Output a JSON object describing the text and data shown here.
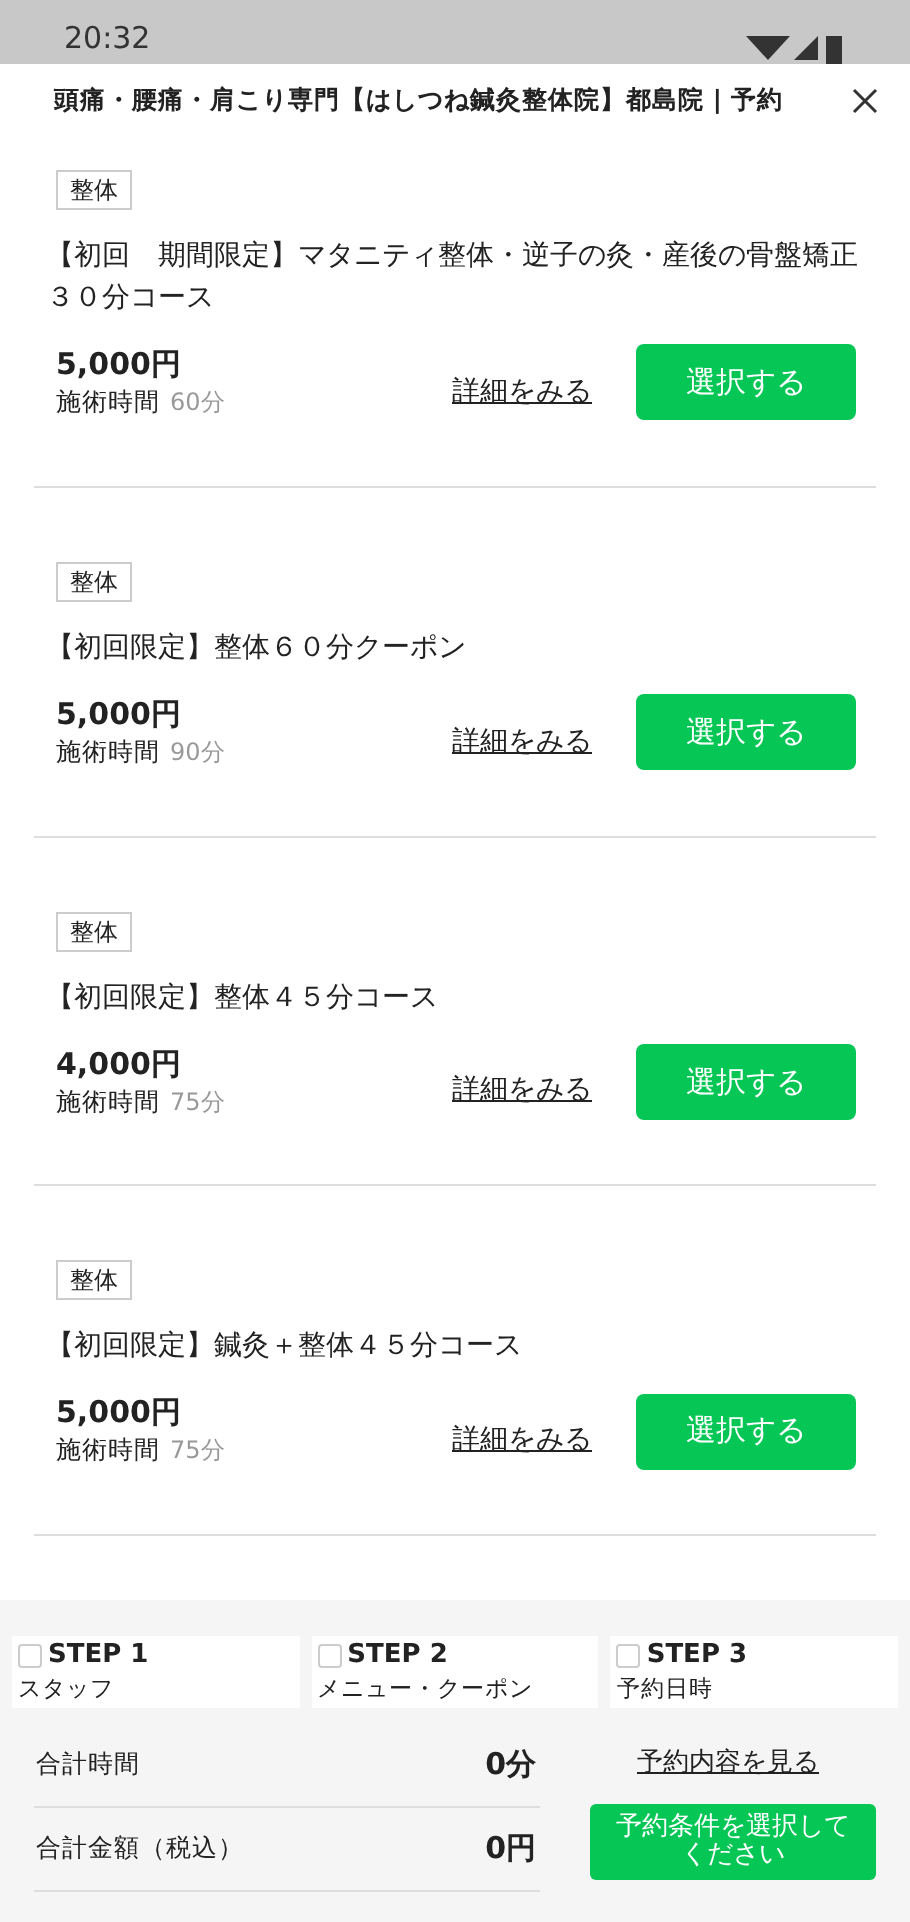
{
  "status_bar": {
    "time": "20:32"
  },
  "header": {
    "title": "頭痛・腰痛・肩こり専門【はしつね鍼灸整体院】都島院 | 予約"
  },
  "menus": [
    {
      "tag": "整体",
      "title": "【初回　期間限定】マタニティ整体・逆子の灸・産後の骨盤矯正３０分コース",
      "price": "5,000円",
      "time_label": "施術時間",
      "duration": "60分",
      "detail_link": "詳細をみる",
      "select_button": "選択する"
    },
    {
      "tag": "整体",
      "title": "【初回限定】整体６０分クーポン",
      "price": "5,000円",
      "time_label": "施術時間",
      "duration": "90分",
      "detail_link": "詳細をみる",
      "select_button": "選択する"
    },
    {
      "tag": "整体",
      "title": "【初回限定】整体４５分コース",
      "price": "4,000円",
      "time_label": "施術時間",
      "duration": "75分",
      "detail_link": "詳細をみる",
      "select_button": "選択する"
    },
    {
      "tag": "整体",
      "title": "【初回限定】鍼灸＋整体４５分コース",
      "price": "5,000円",
      "time_label": "施術時間",
      "duration": "75分",
      "detail_link": "詳細をみる",
      "select_button": "選択する"
    }
  ],
  "steps": [
    {
      "label": "STEP 1",
      "name": "スタッフ",
      "checked": false
    },
    {
      "label": "STEP 2",
      "name": "メニュー・クーポン",
      "checked": false
    },
    {
      "label": "STEP 3",
      "name": "予約日時",
      "checked": false
    }
  ],
  "totals": [
    {
      "label": "合計時間",
      "value": "0分"
    },
    {
      "label": "合計金額（税込）",
      "value": "0円"
    }
  ],
  "view_link": "予約内容を見る",
  "submit_button": "予約条件を選択してください"
}
